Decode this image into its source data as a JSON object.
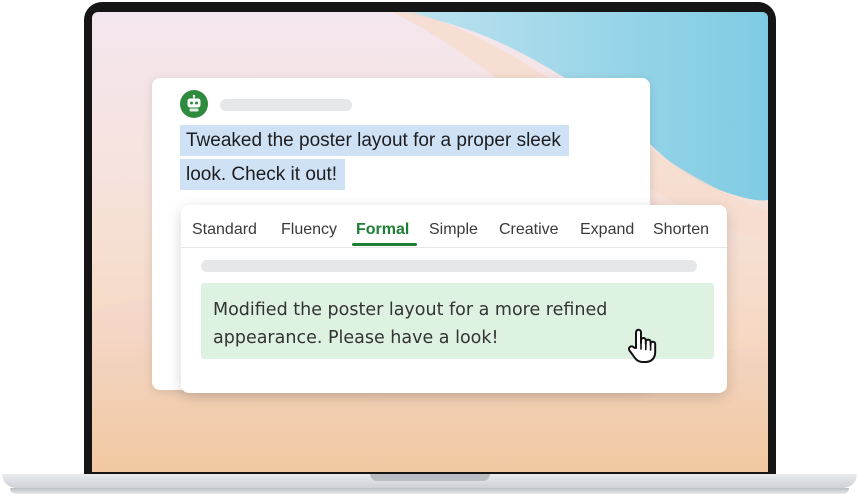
{
  "message": {
    "line1": "Tweaked the poster layout for a proper sleek",
    "line2": "look. Check it out!"
  },
  "rephrase": {
    "tabs": [
      {
        "label": "Standard",
        "active": false
      },
      {
        "label": "Fluency",
        "active": false
      },
      {
        "label": "Formal",
        "active": true
      },
      {
        "label": "Simple",
        "active": false
      },
      {
        "label": "Creative",
        "active": false
      },
      {
        "label": "Expand",
        "active": false
      },
      {
        "label": "Shorten",
        "active": false
      }
    ],
    "result_line1": "Modified the poster layout for a more refined",
    "result_line2": "appearance. Please have a look!"
  },
  "colors": {
    "accent": "#1e7e34",
    "highlight": "#cfe2f5",
    "result_bg": "#ddf2e1",
    "avatar": "#2e8b3e"
  },
  "icons": {
    "avatar": "robot-icon",
    "cursor": "hand-pointer-icon"
  }
}
